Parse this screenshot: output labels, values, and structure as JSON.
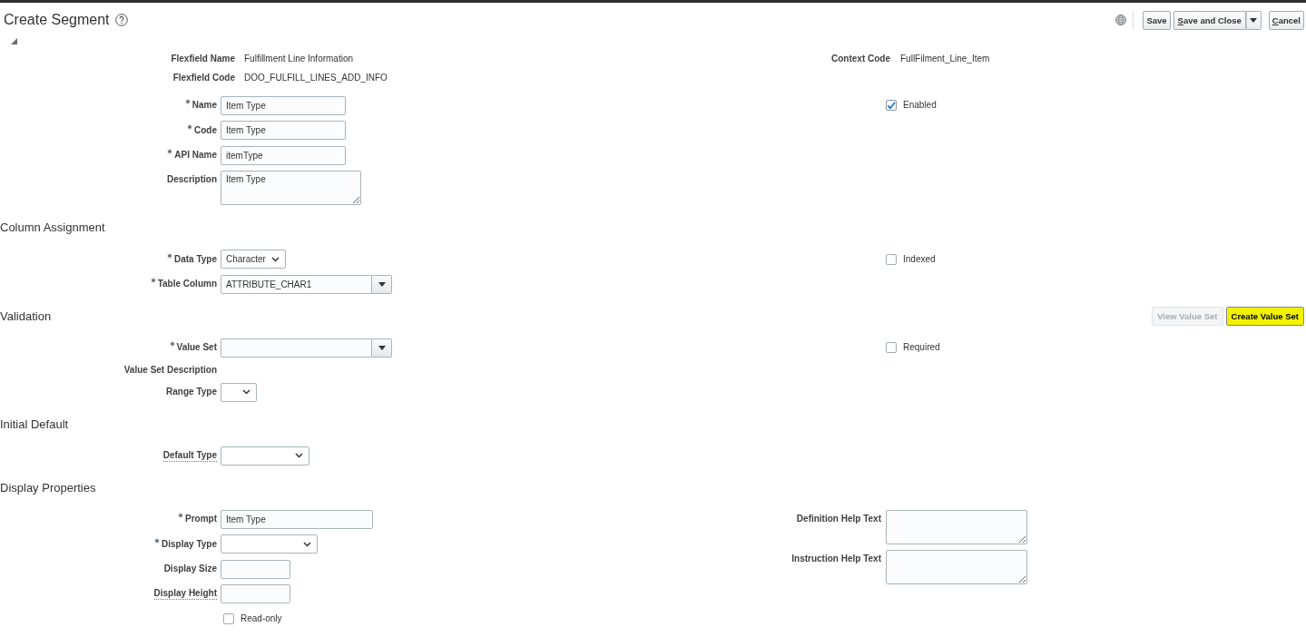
{
  "header": {
    "title": "Create Segment"
  },
  "toolbar": [
    {
      "label": "Save",
      "kind": "button",
      "mnemonic": false
    },
    {
      "label": "Save and Close",
      "kind": "split",
      "mnemonic": true
    },
    {
      "label": "Cancel",
      "kind": "button",
      "mnemonic": true
    }
  ],
  "sections": [
    {
      "left": [
        {
          "kind": "output",
          "label": "Flexfield Name",
          "value": "Fulfillment Line Information",
          "required": false,
          "help_note": false
        },
        {
          "kind": "output",
          "label": "Flexfield Code",
          "value": "DOO_FULFILL_LINES_ADD_INFO",
          "required": false,
          "help_note": false
        }
      ],
      "right": [
        {
          "kind": "output",
          "label": "Context Code",
          "value": "FullFilment_Line_Item",
          "required": false,
          "help_note": false
        }
      ]
    },
    {
      "left": [
        {
          "kind": "text",
          "label": "Name",
          "value": "Item Type",
          "required": true,
          "help_note": false
        },
        {
          "kind": "text",
          "label": "Code",
          "value": "Item Type",
          "required": true,
          "help_note": false
        },
        {
          "kind": "text",
          "label": "API Name",
          "value": "itemType",
          "required": true,
          "help_note": false
        },
        {
          "kind": "textarea",
          "label": "Description",
          "value": "Item Type",
          "required": false,
          "help_note": false
        }
      ],
      "right": [
        {
          "kind": "checkbox",
          "label": "Enabled",
          "checked": true,
          "required": false,
          "help_note": false
        }
      ]
    },
    {
      "heading": "Column Assignment",
      "left": [
        {
          "kind": "select",
          "label": "Data Type",
          "value": "Character",
          "required": true,
          "help_note": false
        },
        {
          "kind": "combo",
          "label": "Table Column",
          "value": "ATTRIBUTE_CHAR1",
          "required": true,
          "help_note": false
        }
      ],
      "right": [
        {
          "kind": "checkbox",
          "label": "Indexed",
          "checked": false,
          "required": false,
          "help_note": false
        }
      ]
    },
    {
      "heading": "Validation",
      "actions": [
        {
          "label": "View Value Set",
          "disabled": true,
          "highlighted": false
        },
        {
          "label": "Create Value Set",
          "disabled": false,
          "highlighted": true
        }
      ],
      "left": [
        {
          "kind": "combo",
          "label": "Value Set",
          "required": true,
          "help_note": false
        },
        {
          "kind": "label",
          "label": "Value Set Description",
          "required": false,
          "help_note": false
        },
        {
          "kind": "select",
          "label": "Range Type",
          "required": false,
          "help_note": false
        }
      ],
      "right": [
        {
          "kind": "checkbox",
          "label": "Required",
          "checked": false,
          "required": false,
          "help_note": false
        }
      ]
    },
    {
      "heading": "Initial Default",
      "left": [
        {
          "kind": "select",
          "label": "Default Type",
          "required": false,
          "help_note": true
        }
      ]
    },
    {
      "heading": "Display Properties",
      "left": [
        {
          "kind": "text",
          "label": "Prompt",
          "value": "Item Type",
          "required": true,
          "help_note": false
        },
        {
          "kind": "select",
          "label": "Display Type",
          "required": true,
          "help_note": false
        },
        {
          "kind": "text",
          "label": "Display Size",
          "required": false,
          "help_note": false
        },
        {
          "kind": "text",
          "label": "Display Height",
          "required": false,
          "help_note": true
        },
        {
          "kind": "checkbox",
          "label": "Read-only",
          "checked": false,
          "required": false,
          "help_note": false
        }
      ],
      "right": [
        {
          "kind": "textarea",
          "label": "Definition Help Text",
          "required": false,
          "help_note": false
        },
        {
          "kind": "textarea",
          "label": "Instruction Help Text",
          "required": false,
          "help_note": false
        }
      ]
    }
  ]
}
